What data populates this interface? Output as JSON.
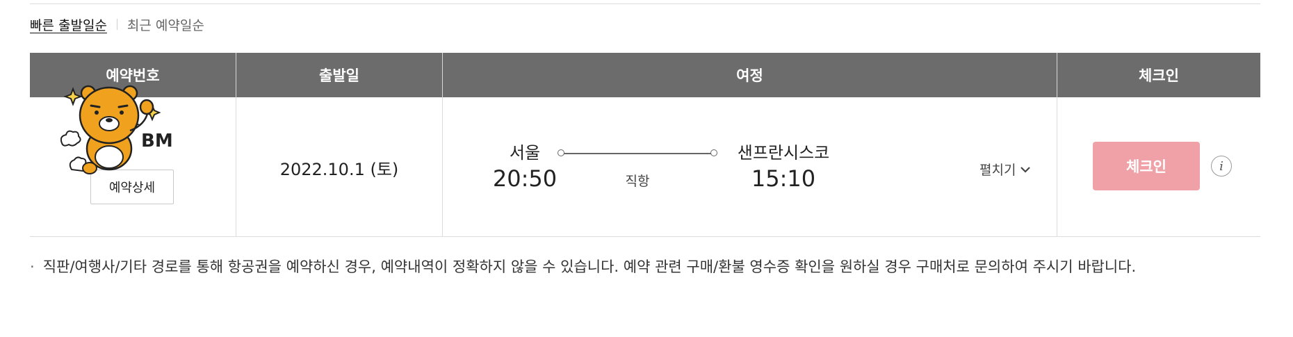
{
  "sort": {
    "options": [
      "빠른 출발일순",
      "최근 예약일순"
    ],
    "active_index": 0
  },
  "table": {
    "headers": [
      "예약번호",
      "출발일",
      "여정",
      "체크인"
    ],
    "row": {
      "booking_code": "BM",
      "detail_button": "예약상세",
      "departure_date": "2022.10.1 (토)",
      "itinerary": {
        "origin_city": "서울",
        "origin_time": "20:50",
        "flight_type": "직항",
        "destination_city": "샌프란시스코",
        "destination_time": "15:10",
        "expand_label": "펼치기"
      },
      "checkin_button": "체크인",
      "info_icon": "i"
    }
  },
  "notice": "직판/여행사/기타 경로를 통해 항공권을 예약하신 경우, 예약내역이 정확하지 않을 수 있습니다. 예약 관련 구매/환불 영수증 확인을 원하실 경우 구매처로 문의하여 주시기 바랍니다.",
  "colors": {
    "header_bg": "#6c6c6c",
    "checkin_disabled": "#efa1a7",
    "sticker_body": "#f0a21f"
  },
  "icons": [
    "chevron-down-icon",
    "info-icon",
    "bear-sticker-icon"
  ]
}
